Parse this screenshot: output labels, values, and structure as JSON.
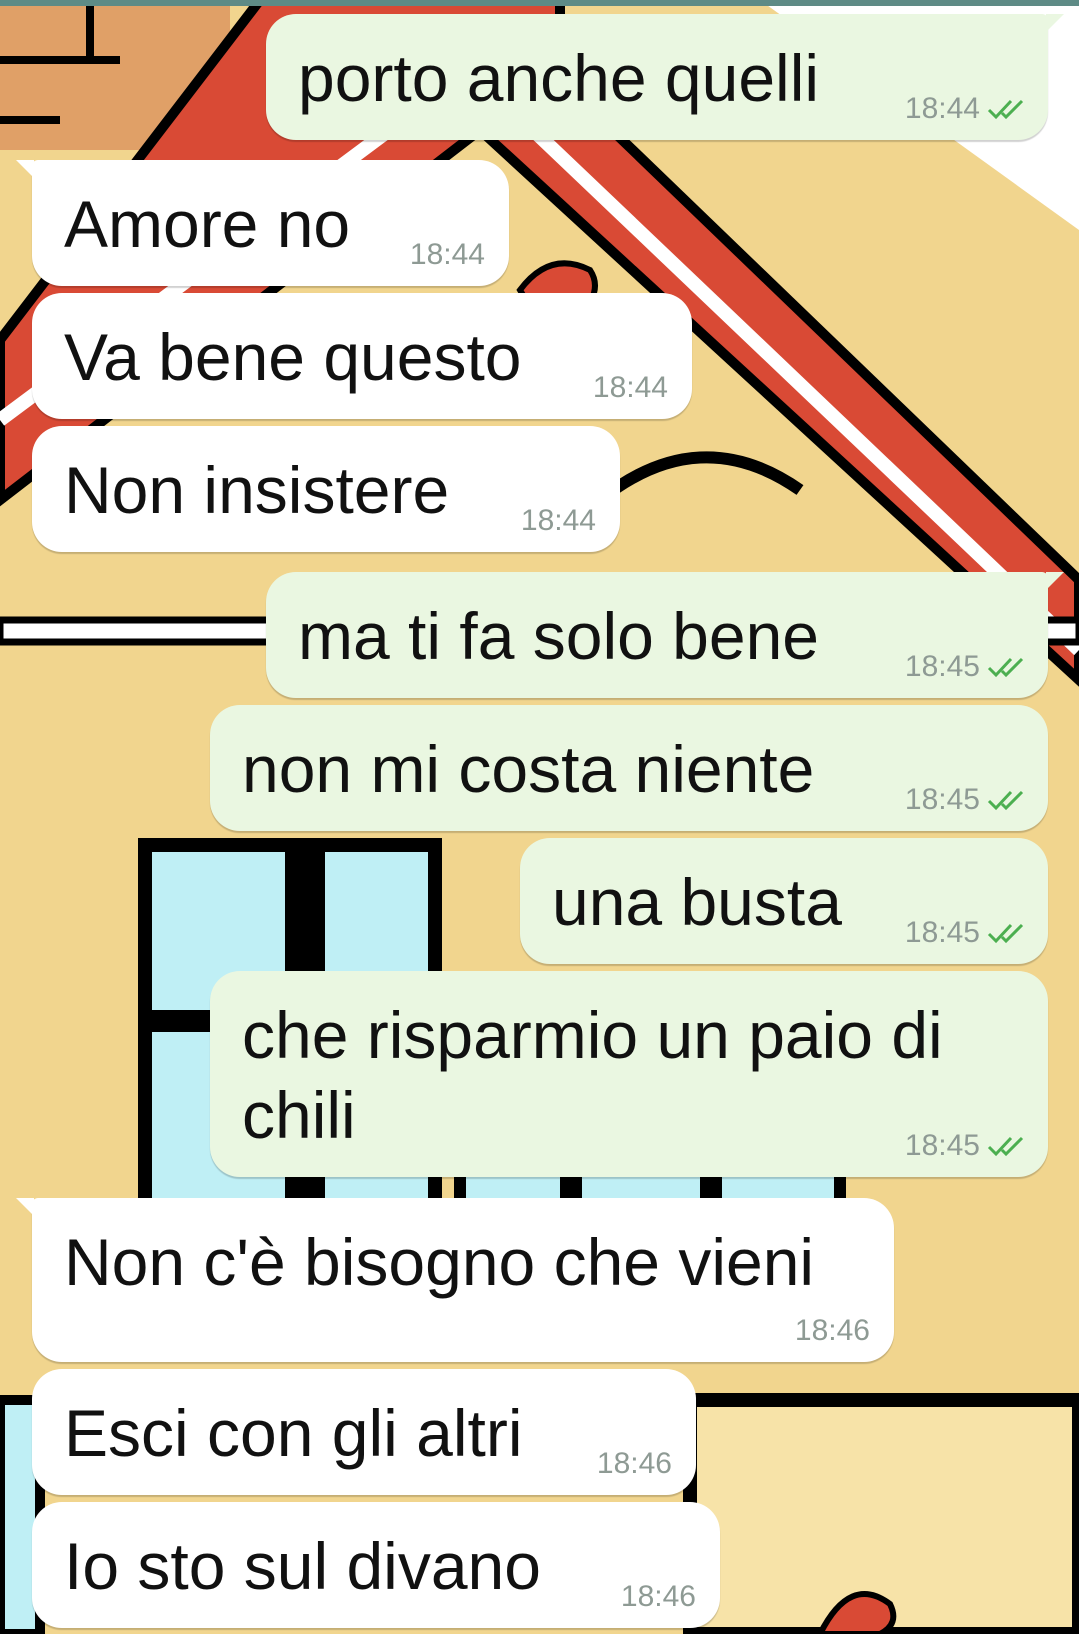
{
  "chat": {
    "messages": [
      {
        "side": "out",
        "text": "porto anche quelli",
        "time": "18:44",
        "status": "read",
        "tick_color": "#4fc3f7"
      },
      {
        "side": "in",
        "text": "Amore no",
        "time": "18:44"
      },
      {
        "side": "in",
        "text": "Va bene questo",
        "time": "18:44"
      },
      {
        "side": "in",
        "text": "Non insistere",
        "time": "18:44"
      },
      {
        "side": "out",
        "text": "ma ti fa solo bene",
        "time": "18:45",
        "status": "read"
      },
      {
        "side": "out",
        "text": "non mi costa niente",
        "time": "18:45",
        "status": "read"
      },
      {
        "side": "out",
        "text": "una busta",
        "time": "18:45",
        "status": "read"
      },
      {
        "side": "out",
        "text": "che risparmio un paio di chili",
        "time": "18:45",
        "status": "read"
      },
      {
        "side": "in",
        "text": "Non c'è bisogno che vieni",
        "time": "18:46"
      },
      {
        "side": "in",
        "text": "Esci con gli altri",
        "time": "18:46"
      },
      {
        "side": "in",
        "text": "Io sto sul divano",
        "time": "18:46"
      }
    ]
  },
  "colors": {
    "incoming_bubble": "#ffffff",
    "outgoing_bubble": "#eaf7e1",
    "ticks": "#4caf50",
    "timestamp": "#8e9a94",
    "wallpaper_base": "#f1d58e",
    "wallpaper_roof": "#d94a35",
    "wallpaper_window": "#bfeff5"
  },
  "icons": {
    "read_receipt": "double-check-icon"
  }
}
